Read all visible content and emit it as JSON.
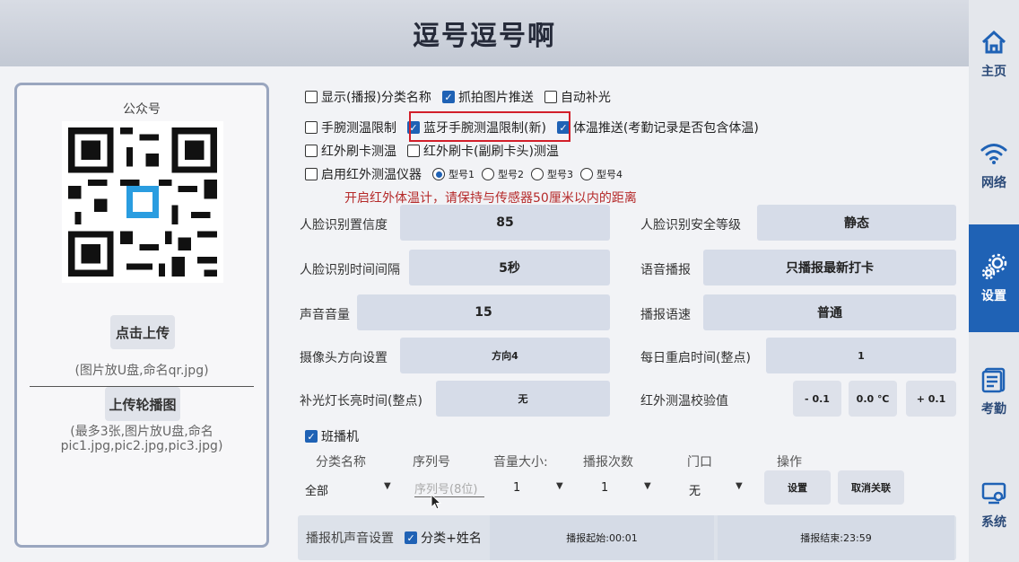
{
  "header": {
    "title": "逗号逗号啊"
  },
  "nav": [
    {
      "label": "主页",
      "icon": "home-icon",
      "active": false
    },
    {
      "label": "网络",
      "icon": "wifi-icon",
      "active": false
    },
    {
      "label": "设置",
      "icon": "gears-icon",
      "active": true
    },
    {
      "label": "考勤",
      "icon": "attendance-icon",
      "active": false
    },
    {
      "label": "系统",
      "icon": "system-icon",
      "active": false
    }
  ],
  "left": {
    "title": "公众号",
    "upload_label": "点击上传",
    "upload_hint": "(图片放U盘,命名qr.jpg)",
    "carousel_label": "上传轮播图",
    "carousel_hint1": "(最多3张,图片放U盘,命名",
    "carousel_hint2": "pic1.jpg,pic2.jpg,pic3.jpg)"
  },
  "options": {
    "show_category": {
      "label": "显示(播报)分类名称",
      "checked": false
    },
    "snapshot_push": {
      "label": "抓拍图片推送",
      "checked": true
    },
    "auto_fill_light": {
      "label": "自动补光",
      "checked": false
    },
    "wrist_temp_limit": {
      "label": "手腕测温限制",
      "checked": false
    },
    "bt_wrist_temp_limit": {
      "label": "蓝牙手腕测温限制(新)",
      "checked": true
    },
    "temp_push": {
      "label": "体温推送(考勤记录是否包含体温)",
      "checked": true
    },
    "ir_card_temp": {
      "label": "红外刷卡测温",
      "checked": false
    },
    "ir_card_sub_temp": {
      "label": "红外刷卡(副刷卡头)测温",
      "checked": false
    },
    "ir_instrument": {
      "label": "启用红外测温仪器",
      "checked": false
    },
    "models": [
      "型号1",
      "型号2",
      "型号3",
      "型号4"
    ],
    "selected_model": 0,
    "warning": "开启红外体温计，请保持与传感器50厘米以内的距离"
  },
  "fields": {
    "confidence": {
      "label": "人脸识别置信度",
      "value": "85"
    },
    "security_level": {
      "label": "人脸识别安全等级",
      "value": "静态"
    },
    "interval": {
      "label": "人脸识别时间间隔",
      "value": "5秒"
    },
    "voice": {
      "label": "语音播报",
      "value": "只播报最新打卡"
    },
    "volume": {
      "label": "声音音量",
      "value": "15"
    },
    "speed": {
      "label": "播报语速",
      "value": "普通"
    },
    "camera": {
      "label": "摄像头方向设置",
      "value": "方向4"
    },
    "restart": {
      "label": "每日重启时间(整点)",
      "value": "1"
    },
    "fill_light": {
      "label": "补光灯长亮时间(整点)",
      "value": "无"
    },
    "ir_calib": {
      "label": "红外测温校验值",
      "minus": "- 0.1",
      "value": "0.0 ℃",
      "plus": "+ 0.1"
    }
  },
  "class_device": {
    "label": "班播机",
    "checked": true,
    "headers": [
      "分类名称",
      "序列号",
      "音量大小:",
      "播报次数",
      "门口",
      "操作"
    ],
    "row": {
      "category": "全部",
      "serial_placeholder": "序列号(8位)",
      "volume": "1",
      "times": "1",
      "door": "无",
      "set_label": "设置",
      "unlink_label": "取消关联"
    }
  },
  "bottom": {
    "label": "播报机声音设置",
    "category_name": {
      "label": "分类+姓名",
      "checked": true
    },
    "start": "播报起始:00:01",
    "end": "播报结束:23:59"
  }
}
